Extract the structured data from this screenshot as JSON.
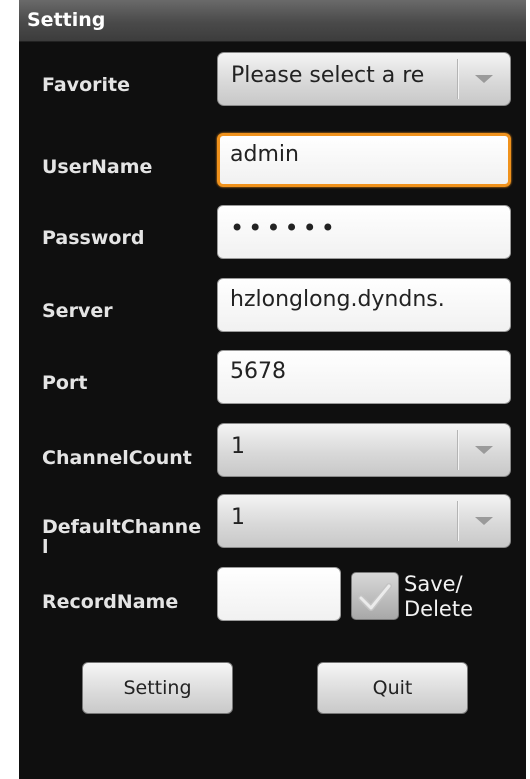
{
  "title": "Setting",
  "form": {
    "favorite": {
      "label": "Favorite",
      "value": "Please select a re"
    },
    "username": {
      "label": "UserName",
      "value": "admin"
    },
    "password": {
      "label": "Password",
      "value": "••••••"
    },
    "server": {
      "label": "Server",
      "value": "hzlonglong.dyndns."
    },
    "port": {
      "label": "Port",
      "value": "5678"
    },
    "channel_count": {
      "label": "ChannelCount",
      "value": "1"
    },
    "default_channel": {
      "label": "DefaultChannel",
      "value": "1"
    },
    "record_name": {
      "label": "RecordName",
      "value": ""
    },
    "save_delete": {
      "label": "Save/\nDelete",
      "checked": true
    }
  },
  "buttons": {
    "setting": "Setting",
    "quit": "Quit"
  },
  "colors": {
    "focus_border": "#f0921c",
    "background": "#0f0f0f",
    "titlebar": "#4a4a4a"
  }
}
